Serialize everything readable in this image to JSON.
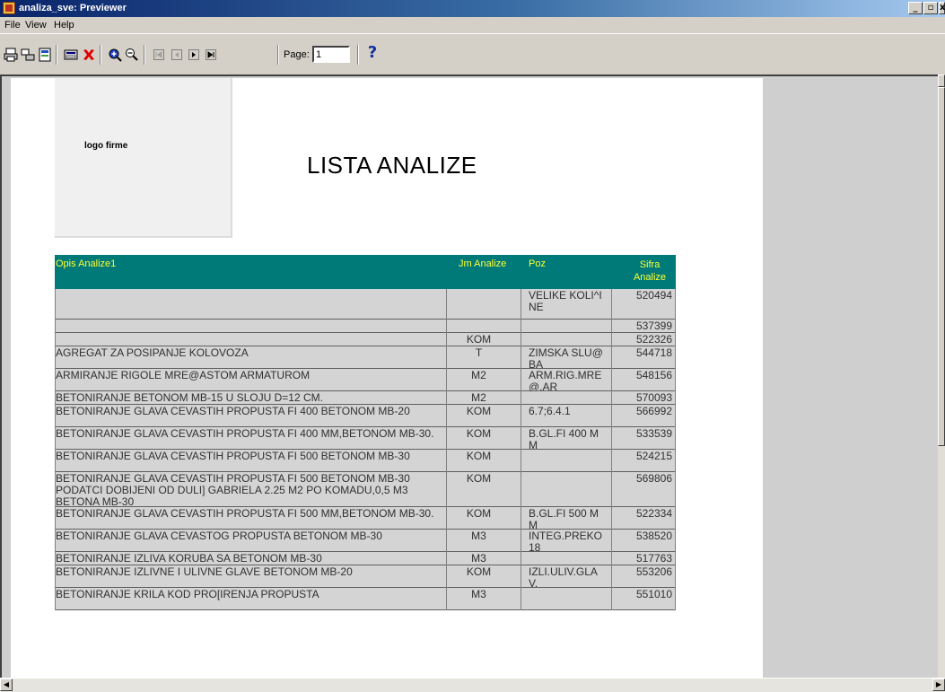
{
  "window": {
    "title": "analiza_sve: Previewer",
    "minimize": "_",
    "maximize": "▫",
    "close": "x"
  },
  "menu": [
    "File",
    "View",
    "Help"
  ],
  "toolbar": {
    "page_label": "Page:",
    "page_value": "1",
    "help_label": "?"
  },
  "report": {
    "logo_text": "logo firme",
    "title": "LISTA ANALIZE",
    "columns": {
      "opis": "Opis Analize1",
      "jm": "Jm Analize",
      "poz": "Poz",
      "sifra": "Sifra Analize"
    },
    "rows": [
      {
        "opis": "",
        "jm": "",
        "poz": "VELIKE KOLI^INE",
        "sifra": "520494"
      },
      {
        "opis": "",
        "jm": "",
        "poz": "",
        "sifra": "537399"
      },
      {
        "opis": "",
        "jm": "KOM",
        "poz": "",
        "sifra": "522326"
      },
      {
        "opis": "AGREGAT ZA POSIPANJE KOLOVOZA",
        "jm": "T",
        "poz": "ZIMSKA SLU@BA",
        "sifra": "544718"
      },
      {
        "opis": "ARMIRANJE RIGOLE MRE@ASTOM ARMATUROM",
        "jm": "M2",
        "poz": "ARM.RIG.MRE@.AR",
        "sifra": "548156"
      },
      {
        "opis": "BETONIRANJE  BETONOM MB-15 U SLOJU D=12 CM.",
        "jm": "M2",
        "poz": "",
        "sifra": "570093"
      },
      {
        "opis": "BETONIRANJE GLAVA CEVASTIH PROPUSTA FI 400 BETONOM MB-20",
        "jm": "KOM",
        "poz": "6.7;6.4.1",
        "sifra": "566992"
      },
      {
        "opis": "BETONIRANJE GLAVA CEVASTIH PROPUSTA FI 400 MM,BETONOM MB-30.",
        "jm": "KOM",
        "poz": "B.GL.FI 400 MM",
        "sifra": "533539"
      },
      {
        "opis": "BETONIRANJE GLAVA CEVASTIH PROPUSTA FI 500 BETONOM MB-30",
        "jm": "KOM",
        "poz": "",
        "sifra": "524215"
      },
      {
        "opis": "BETONIRANJE GLAVA CEVASTIH PROPUSTA FI 500 BETONOM MB-30 PODATCI DOBIJENI OD DULI] GABRIELA 2.25 M2 PO KOMADU,0,5 M3 BETONA MB-30",
        "jm": "KOM",
        "poz": "",
        "sifra": "569806"
      },
      {
        "opis": "BETONIRANJE GLAVA CEVASTIH PROPUSTA FI 500 MM,BETONOM MB-30.",
        "jm": "KOM",
        "poz": "B.GL.FI 500 MM",
        "sifra": "522334"
      },
      {
        "opis": "BETONIRANJE GLAVA CEVASTOG PROPUSTA BETONOM MB-30",
        "jm": "M3",
        "poz": "INTEG.PREKO 18",
        "sifra": "538520"
      },
      {
        "opis": "BETONIRANJE IZLIVA KORUBA SA BETONOM MB-30",
        "jm": "M3",
        "poz": "",
        "sifra": "517763"
      },
      {
        "opis": "BETONIRANJE IZLIVNE I ULIVNE GLAVE BETONOM MB-20",
        "jm": "KOM",
        "poz": "IZLI.ULIV.GLAV.",
        "sifra": "553206"
      },
      {
        "opis": "BETONIRANJE KRILA KOD PRO[IRENJA PROPUSTA",
        "jm": "M3",
        "poz": "",
        "sifra": "551010"
      }
    ]
  }
}
